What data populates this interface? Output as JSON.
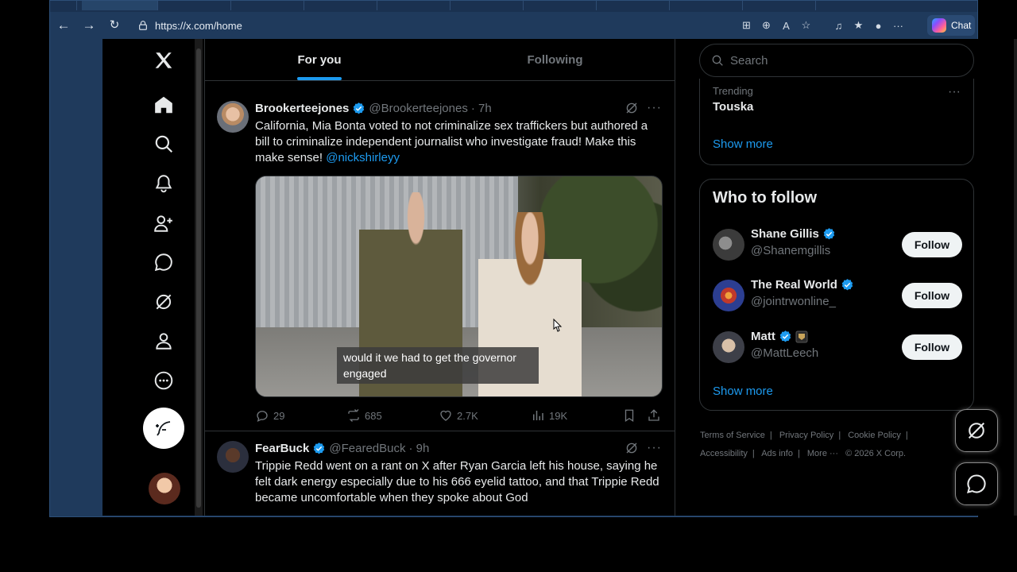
{
  "browser": {
    "url": "https://x.com/home",
    "chat_label": "Chat"
  },
  "tabs": {
    "for_you": "For you",
    "following": "Following"
  },
  "tweets": [
    {
      "name": "Brookerteejones",
      "handle": "@Brookerteejones",
      "time": "· 7h",
      "text": "California, Mia Bonta voted to not criminalize sex traffickers but authored a bill to criminalize independent journalist who investigate fraud! Make this make sense!",
      "mention": "@nickshirleyy",
      "caption": "would it we had to get the governor engaged",
      "replies": "29",
      "reposts": "685",
      "likes": "2.7K",
      "views": "19K"
    },
    {
      "name": "FearBuck",
      "handle": "@FearedBuck",
      "time": "· 9h",
      "text": "Trippie Redd went on a rant on X after Ryan Garcia left his house, saying he felt dark energy especially due to his 666 eyelid tattoo, and that Trippie Redd became uncomfortable when they spoke about God"
    }
  ],
  "right": {
    "search_placeholder": "Search",
    "trending_label": "Trending",
    "trending_topic": "Touska",
    "show_more": "Show more",
    "who_to_follow": "Who to follow",
    "follow_label": "Follow",
    "users": [
      {
        "name": "Shane Gillis",
        "handle": "@Shanemgillis"
      },
      {
        "name": "The Real World",
        "handle": "@jointrwonline_"
      },
      {
        "name": "Matt",
        "handle": "@MattLeech"
      }
    ],
    "footer": {
      "terms": "Terms of Service",
      "privacy": "Privacy Policy",
      "cookie": "Cookie Policy",
      "accessibility": "Accessibility",
      "ads": "Ads info",
      "more": "More ···",
      "copyright": "© 2026 X Corp."
    }
  },
  "colors": {
    "accent": "#1d9bf0",
    "background": "#000000",
    "border": "#2f3336",
    "muted": "#71767b"
  }
}
